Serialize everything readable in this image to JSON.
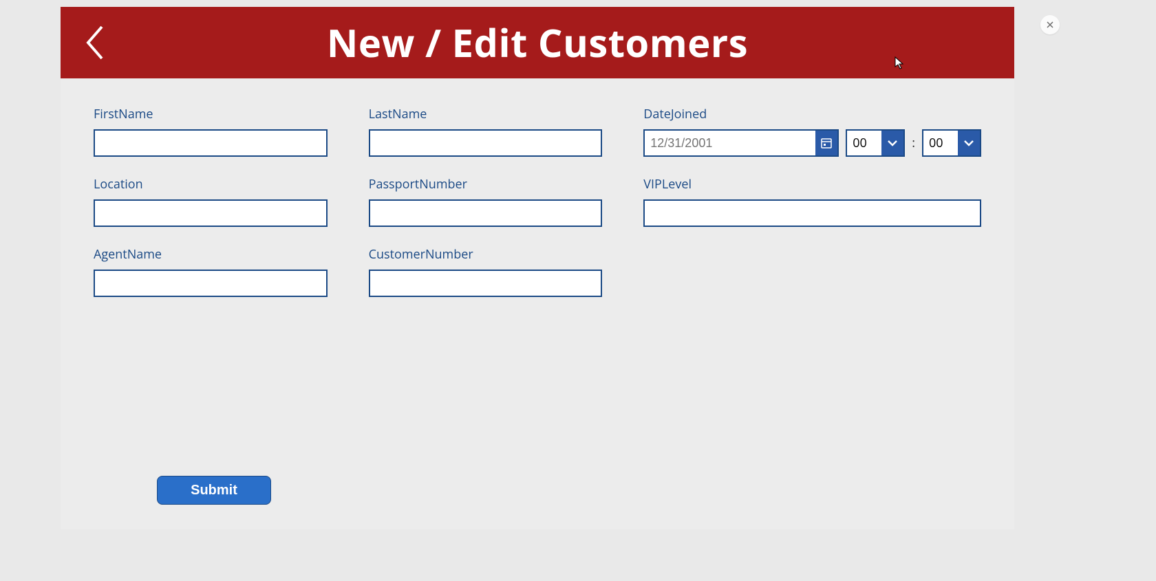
{
  "header": {
    "title": "New / Edit Customers"
  },
  "form": {
    "firstName": {
      "label": "FirstName",
      "value": ""
    },
    "lastName": {
      "label": "LastName",
      "value": ""
    },
    "dateJoined": {
      "label": "DateJoined",
      "date_placeholder": "12/31/2001",
      "hour": "00",
      "minute": "00",
      "separator": ":"
    },
    "location": {
      "label": "Location",
      "value": ""
    },
    "passportNumber": {
      "label": "PassportNumber",
      "value": ""
    },
    "vipLevel": {
      "label": "VIPLevel",
      "value": ""
    },
    "agentName": {
      "label": "AgentName",
      "value": ""
    },
    "customerNumber": {
      "label": "CustomerNumber",
      "value": ""
    }
  },
  "actions": {
    "submit_label": "Submit"
  }
}
